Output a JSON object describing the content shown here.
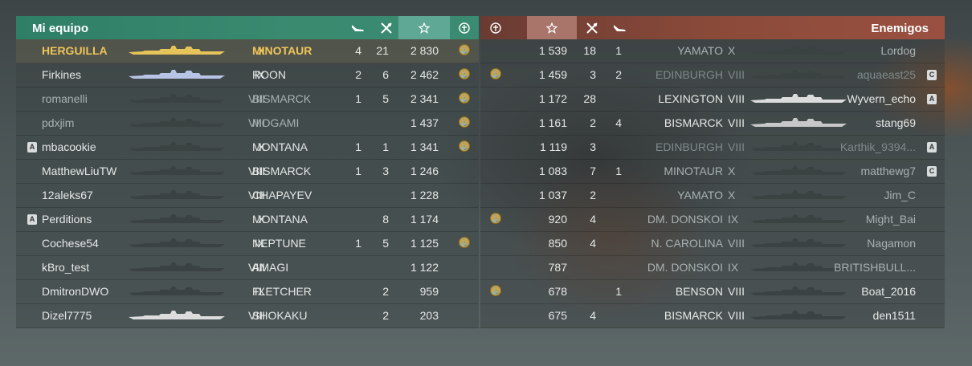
{
  "my_team": {
    "title": "Mi equipo",
    "rows": [
      {
        "name": "HERGUILLA",
        "tier": "X",
        "ship": "MINOTAUR",
        "planes": "4",
        "frags": "21",
        "xp": "2 830",
        "medal": true,
        "badge": "",
        "me": true,
        "ship_color": "#e6c45a",
        "style": "normal"
      },
      {
        "name": "Firkines",
        "tier": "IX",
        "ship": "ROON",
        "planes": "2",
        "frags": "6",
        "xp": "2 462",
        "medal": true,
        "badge": "",
        "me": false,
        "ship_color": "#b8c4e6",
        "style": "normal"
      },
      {
        "name": "romanelli",
        "tier": "VIII",
        "ship": "BISMARCK",
        "planes": "1",
        "frags": "5",
        "xp": "2 341",
        "medal": true,
        "badge": "",
        "me": false,
        "ship_color": "#3a4242",
        "style": "dim"
      },
      {
        "name": "pdxjim",
        "tier": "VIII",
        "ship": "MOGAMI",
        "planes": "",
        "frags": "",
        "xp": "1 437",
        "medal": true,
        "badge": "",
        "me": false,
        "ship_color": "#3a4242",
        "style": "dim"
      },
      {
        "name": "mbacookie",
        "tier": "X",
        "ship": "MONTANA",
        "planes": "1",
        "frags": "1",
        "xp": "1 341",
        "medal": true,
        "badge": "A",
        "me": false,
        "ship_color": "#3a4242",
        "style": "normal"
      },
      {
        "name": "MatthewLiuTW",
        "tier": "VIII",
        "ship": "BISMARCK",
        "planes": "1",
        "frags": "3",
        "xp": "1 246",
        "medal": false,
        "badge": "",
        "me": false,
        "ship_color": "#3a4242",
        "style": "normal"
      },
      {
        "name": "12aleks67",
        "tier": "VIII",
        "ship": "CHAPAYEV",
        "planes": "",
        "frags": "",
        "xp": "1 228",
        "medal": false,
        "badge": "",
        "me": false,
        "ship_color": "#3a4242",
        "style": "normal"
      },
      {
        "name": "Perditions",
        "tier": "X",
        "ship": "MONTANA",
        "planes": "",
        "frags": "8",
        "xp": "1 174",
        "medal": false,
        "badge": "A",
        "me": false,
        "ship_color": "#3a4242",
        "style": "normal"
      },
      {
        "name": "Cochese54",
        "tier": "IX",
        "ship": "NEPTUNE",
        "planes": "1",
        "frags": "5",
        "xp": "1 125",
        "medal": true,
        "badge": "",
        "me": false,
        "ship_color": "#3a4242",
        "style": "normal"
      },
      {
        "name": "kBro_test",
        "tier": "VIII",
        "ship": "AMAGI",
        "planes": "",
        "frags": "",
        "xp": "1 122",
        "medal": false,
        "badge": "",
        "me": false,
        "ship_color": "#3a4242",
        "style": "normal"
      },
      {
        "name": "DmitronDWO",
        "tier": "IX",
        "ship": "FLETCHER",
        "planes": "",
        "frags": "2",
        "xp": "959",
        "medal": false,
        "badge": "",
        "me": false,
        "ship_color": "#3a4242",
        "style": "normal"
      },
      {
        "name": "Dizel7775",
        "tier": "VIII",
        "ship": "SHOKAKU",
        "planes": "",
        "frags": "2",
        "xp": "203",
        "medal": false,
        "badge": "",
        "me": false,
        "ship_color": "#dcdcdc",
        "style": "normal"
      }
    ]
  },
  "enemy_team": {
    "title": "Enemigos",
    "rows": [
      {
        "name": "Lordog",
        "tier": "X",
        "ship": "YAMATO",
        "planes": "1",
        "frags": "18",
        "xp": "1 539",
        "medal": false,
        "badge": "",
        "ship_color": "#3a4242",
        "style": "dim"
      },
      {
        "name": "aquaeast25",
        "tier": "VIII",
        "ship": "EDINBURGH",
        "planes": "2",
        "frags": "3",
        "xp": "1 459",
        "medal": true,
        "badge": "C",
        "ship_color": "#3a4242",
        "style": "dimmer"
      },
      {
        "name": "Wyvern_echo",
        "tier": "VIII",
        "ship": "LEXINGTON",
        "planes": "",
        "frags": "28",
        "xp": "1 172",
        "medal": false,
        "badge": "A",
        "ship_color": "#dcdcdc",
        "style": "normal"
      },
      {
        "name": "stang69",
        "tier": "VIII",
        "ship": "BISMARCK",
        "planes": "4",
        "frags": "2",
        "xp": "1 161",
        "medal": false,
        "badge": "",
        "ship_color": "#c8c8c8",
        "style": "normal"
      },
      {
        "name": "Karthik_9394...",
        "tier": "VIII",
        "ship": "EDINBURGH",
        "planes": "",
        "frags": "3",
        "xp": "1 119",
        "medal": false,
        "badge": "A",
        "ship_color": "#3a4242",
        "style": "dimmer"
      },
      {
        "name": "matthewg7",
        "tier": "X",
        "ship": "MINOTAUR",
        "planes": "1",
        "frags": "7",
        "xp": "1 083",
        "medal": false,
        "badge": "C",
        "ship_color": "#3a4242",
        "style": "dim"
      },
      {
        "name": "Jim_C",
        "tier": "X",
        "ship": "YAMATO",
        "planes": "",
        "frags": "2",
        "xp": "1 037",
        "medal": false,
        "badge": "",
        "ship_color": "#3a4242",
        "style": "dim"
      },
      {
        "name": "Might_Bai",
        "tier": "IX",
        "ship": "DM. DONSKOI",
        "planes": "",
        "frags": "4",
        "xp": "920",
        "medal": true,
        "badge": "",
        "ship_color": "#3a4242",
        "style": "dim"
      },
      {
        "name": "Nagamon",
        "tier": "VIII",
        "ship": "N. CAROLINA",
        "planes": "",
        "frags": "4",
        "xp": "850",
        "medal": false,
        "badge": "",
        "ship_color": "#3a4242",
        "style": "dim"
      },
      {
        "name": "BRITISHBULL...",
        "tier": "IX",
        "ship": "DM. DONSKOI",
        "planes": "",
        "frags": "",
        "xp": "787",
        "medal": false,
        "badge": "",
        "ship_color": "#3a4242",
        "style": "dim"
      },
      {
        "name": "Boat_2016",
        "tier": "VIII",
        "ship": "BENSON",
        "planes": "1",
        "frags": "",
        "xp": "678",
        "medal": true,
        "badge": "",
        "ship_color": "#3a4242",
        "style": "normal"
      },
      {
        "name": "den1511",
        "tier": "VIII",
        "ship": "BISMARCK",
        "planes": "",
        "frags": "4",
        "xp": "675",
        "medal": false,
        "badge": "",
        "ship_color": "#3a4242",
        "style": "normal"
      }
    ]
  },
  "header_icons": {
    "planes": "plane-icon",
    "frags": "kills-icon",
    "xp": "star-icon",
    "medal": "medal-icon"
  },
  "colors": {
    "my_team_header": "#3a8a70",
    "my_team_highlight": "#5fa896",
    "enemy_header": "#8a4a3a",
    "enemy_highlight": "#a9756a",
    "player_gold": "#f0c45a"
  }
}
